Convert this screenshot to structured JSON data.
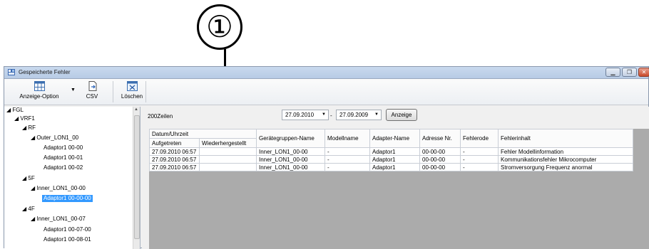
{
  "callout": {
    "number": "①"
  },
  "window": {
    "title": "Gespeicherte Fehler"
  },
  "toolbar": {
    "anzeige_option": "Anzeige-Option",
    "csv": "CSV",
    "loeschen": "Löschen"
  },
  "tree": {
    "items": [
      {
        "label": "FGL",
        "expander": "◢"
      },
      {
        "label": "VRF1",
        "expander": "◢"
      },
      {
        "label": "RF",
        "expander": "◢"
      },
      {
        "label": "Outer_LON1_00",
        "expander": "◢"
      },
      {
        "label": "Adaptor1 00-00"
      },
      {
        "label": "Adaptor1 00-01"
      },
      {
        "label": "Adaptor1 00-02"
      },
      {
        "label": "5F",
        "expander": "◢"
      },
      {
        "label": "Inner_LON1_00-00",
        "expander": "◢"
      },
      {
        "label": "Adaptor1 00-00-00"
      },
      {
        "label": "4F",
        "expander": "◢"
      },
      {
        "label": "Inner_LON1_00-07",
        "expander": "◢"
      },
      {
        "label": "Adaptor1 00-07-00"
      },
      {
        "label": "Adaptor1 00-08-01"
      }
    ]
  },
  "filter": {
    "rows_label": "200Zeilen",
    "date_from": "27.09.2010",
    "date_to": "27.09.2009",
    "dash": "-",
    "show_button": "Anzeige"
  },
  "table": {
    "headers": {
      "datum_uhrzeit": "Datum/Uhrzeit",
      "aufgetreten": "Aufgetreten",
      "wiederhergestellt": "Wiederhergestellt",
      "geraetegruppen": "Gerätegruppen-Name",
      "modellname": "Modellname",
      "adapter": "Adapter-Name",
      "adresse": "Adresse Nr.",
      "fehlercode": "Fehlerode",
      "fehlerinhalt": "Fehlerinhalt"
    },
    "rows": [
      {
        "aufgetreten": "27.09.2010 06:57",
        "wiederhergestellt": "",
        "geraetegruppen": "Inner_LON1_00-00",
        "modellname": "-",
        "adapter": "Adaptor1",
        "adresse": "00-00-00",
        "fehlercode": "-",
        "fehlerinhalt": "Fehler Modellinformation"
      },
      {
        "aufgetreten": "27.09.2010 06:57",
        "wiederhergestellt": "",
        "geraetegruppen": "Inner_LON1_00-00",
        "modellname": "-",
        "adapter": "Adaptor1",
        "adresse": "00-00-00",
        "fehlercode": "-",
        "fehlerinhalt": "Kommunikationsfehler Mikrocomputer"
      },
      {
        "aufgetreten": "27.09.2010 06:57",
        "wiederhergestellt": "",
        "geraetegruppen": "Inner_LON1_00-00",
        "modellname": "-",
        "adapter": "Adaptor1",
        "adresse": "00-00-00",
        "fehlercode": "-",
        "fehlerinhalt": "Stromversorgung Frequenz anormal"
      }
    ]
  },
  "colors": {
    "selection": "#3399ff",
    "grid_empty": "#ababab",
    "titlebar": "#c9d9ee"
  }
}
